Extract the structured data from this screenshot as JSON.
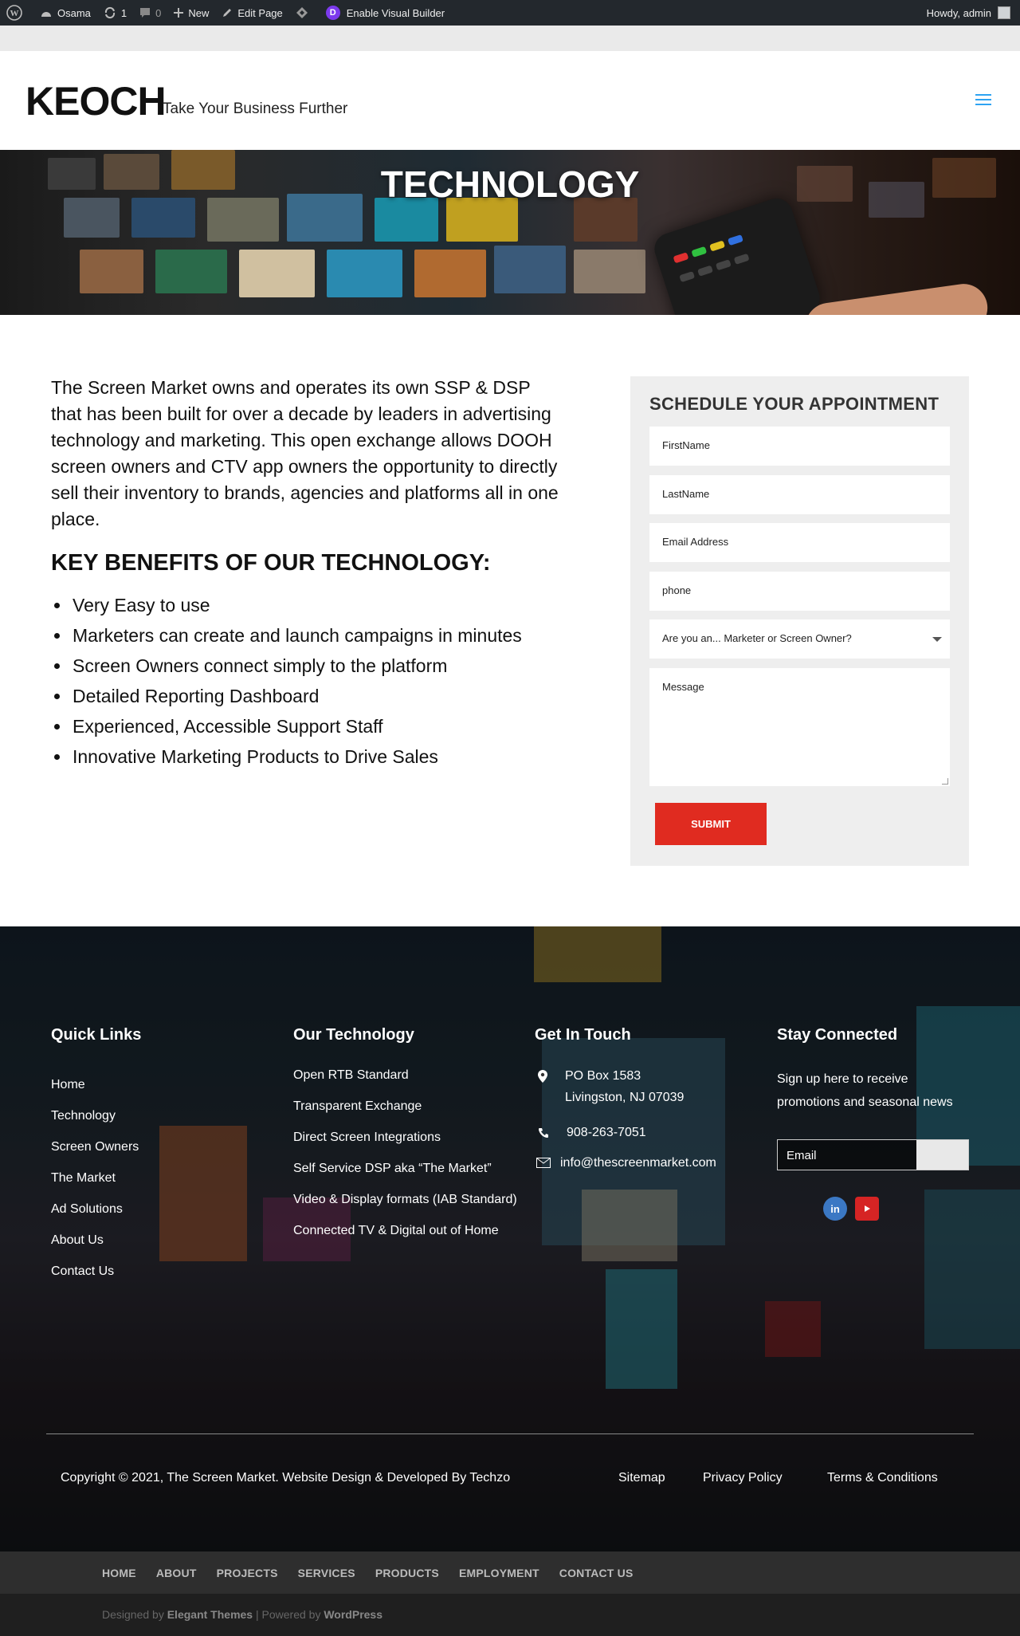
{
  "adminbar": {
    "site_name": "Osama",
    "updates_count": "1",
    "comments_count": "0",
    "new_label": "New",
    "edit_label": "Edit Page",
    "visual_builder_label": "Enable Visual Builder",
    "greeting": "Howdy, admin"
  },
  "header": {
    "logo": "KEOCH",
    "tagline": "Take Your Business Further"
  },
  "hero": {
    "title": "TECHNOLOGY"
  },
  "main": {
    "intro": "The Screen Market owns and operates its own SSP & DSP that has been built for over a decade by leaders in advertising technology and marketing. This open exchange allows DOOH screen owners and CTV app owners the opportunity to directly sell their inventory to brands, agencies and platforms all in one place.",
    "benefits_title": "KEY BENEFITS OF OUR TECHNOLOGY:",
    "benefits": [
      "Very Easy to use",
      "Marketers can create and launch campaigns in minutes",
      "Screen Owners connect simply to the platform",
      "Detailed Reporting Dashboard",
      "Experienced, Accessible Support Staff",
      "Innovative Marketing Products to Drive Sales"
    ]
  },
  "form": {
    "title": "SCHEDULE YOUR APPOINTMENT",
    "first_name": "FirstName",
    "last_name": "LastName",
    "email": "Email Address",
    "phone": "phone",
    "role_select": "Are you an... Marketer or Screen Owner?",
    "message": "Message",
    "submit": "SUBMIT"
  },
  "footer": {
    "quick_links_title": "Quick Links",
    "quick_links": [
      "Home",
      "Technology",
      "Screen Owners",
      "The Market",
      "Ad Solutions",
      "About Us",
      "Contact Us"
    ],
    "tech_title": "Our Technology",
    "tech_links": [
      "Open RTB Standard",
      "Transparent Exchange",
      "Direct Screen Integrations",
      "Self Service DSP aka “The Market”",
      "Video & Display formats (IAB Standard)",
      "Connected TV & Digital out of Home"
    ],
    "contact_title": "Get In Touch",
    "address_line1": "PO Box 1583",
    "address_line2": "Livingston, NJ 07039",
    "phone": "908-263-7051",
    "email": "info@thescreenmarket.com",
    "stay_title": "Stay Connected",
    "signup_line1": "Sign up here to receive",
    "signup_line2": "promotions and seasonal news",
    "email_placeholder": "Email",
    "copyright": "Copyright © 2021, The Screen Market. Website Design & Developed By Techzo",
    "legal_links": [
      "Sitemap",
      "Privacy Policy",
      "Terms & Conditions"
    ]
  },
  "bottom_nav": [
    "HOME",
    "ABOUT",
    "PROJECTS",
    "SERVICES",
    "PRODUCTS",
    "EMPLOYMENT",
    "CONTACT US"
  ],
  "credits": {
    "designed_by": "Designed by",
    "elegant": "Elegant Themes",
    "powered_by": "| Powered by",
    "wordpress": "WordPress"
  },
  "colors": {
    "accent": "#2ea3f2",
    "submit": "#e02b20",
    "adminbar": "#23282d",
    "divi": "#7c3aed"
  }
}
